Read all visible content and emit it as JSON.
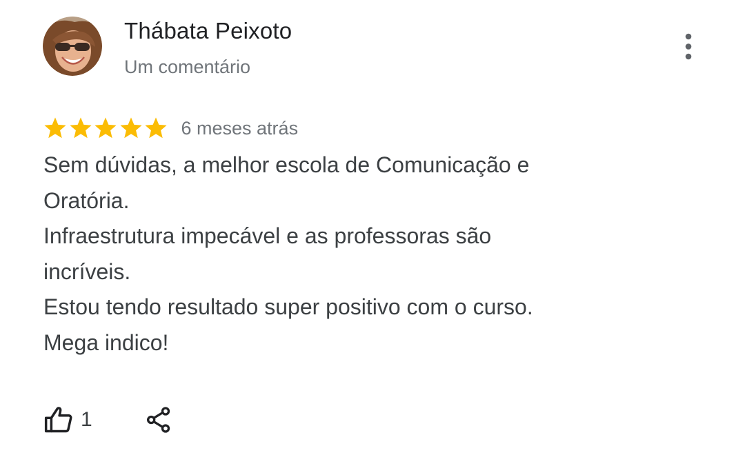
{
  "review": {
    "author_name": "Thábata Peixoto",
    "author_subtitle": "Um comentário",
    "rating": 5,
    "rating_max": 5,
    "star_color": "#fbbc04",
    "time_ago": "6 meses atrás",
    "text_lines": [
      "Sem dúvidas, a melhor escola de Comunicação e",
      "Oratória.",
      "Infraestrutura impecável e as professoras são",
      "incríveis.",
      "Estou tendo resultado super positivo com o curso.",
      "Mega indico!"
    ],
    "like_count": "1"
  },
  "icons": {
    "avatar": "avatar-photo",
    "more": "more-vertical-icon",
    "star": "star-icon",
    "like": "thumbs-up-icon",
    "share": "share-icon"
  }
}
